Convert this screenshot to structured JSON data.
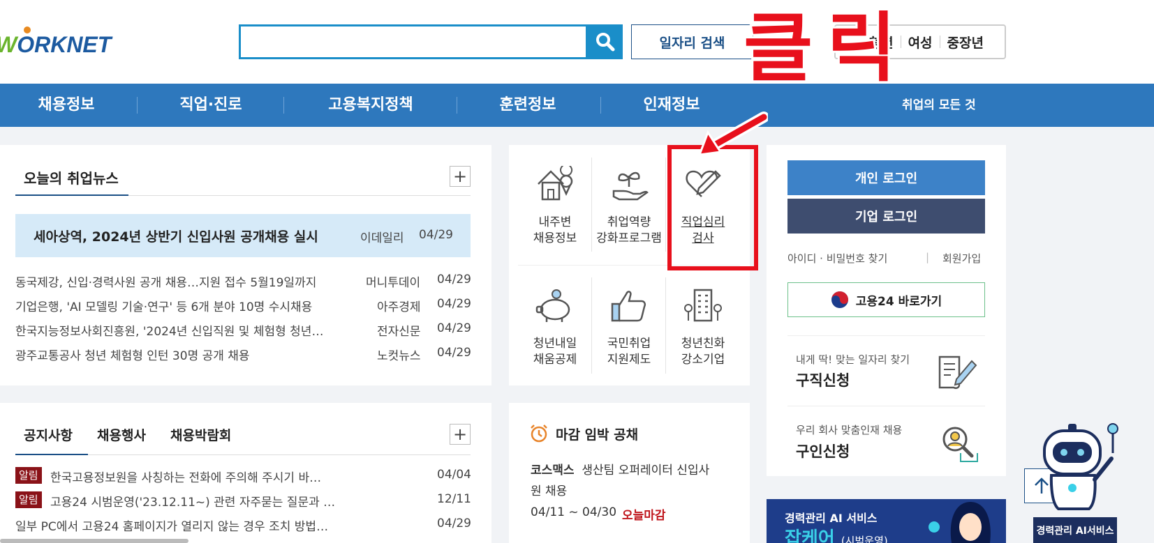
{
  "header": {
    "logo_text": "WORKNET",
    "logo_prefix": "W",
    "logo_rest": "ORKNET",
    "job_search_label": "일자리 검색",
    "quick_links": [
      "청년",
      "여성",
      "중장년"
    ]
  },
  "nav": {
    "items": [
      "채용정보",
      "직업·진로",
      "고용복지정책",
      "훈련정보",
      "인재정보"
    ],
    "extra": "취업의 모든 것"
  },
  "news": {
    "tab_title": "오늘의 취업뉴스",
    "headline": {
      "title": "세아상역, 2024년 상반기 신입사원 공개채용 실시",
      "source": "이데일리",
      "date": "04/29"
    },
    "rows": [
      {
        "title": "동국제강, 신입·경력사원 공개 채용…지원 접수 5월19일까지",
        "source": "머니투데이",
        "date": "04/29"
      },
      {
        "title": "기업은행, 'AI 모델링 기술·연구' 등 6개 분야 10명 수시채용",
        "source": "아주경제",
        "date": "04/29"
      },
      {
        "title": "한국지능정보사회진흥원, '2024년 신입직원 및 체험형 청년…",
        "source": "전자신문",
        "date": "04/29"
      },
      {
        "title": "광주교통공사 청년 체험형 인턴 30명 공개 채용",
        "source": "노컷뉴스",
        "date": "04/29"
      }
    ]
  },
  "tiles": [
    {
      "line1": "내주변",
      "line2": "채용정보",
      "icon": "house-location-icon"
    },
    {
      "line1": "취업역량",
      "line2": "강화프로그램",
      "icon": "plant-hand-icon"
    },
    {
      "line1": "직업심리",
      "line2": "검사",
      "icon": "heart-pen-icon"
    },
    {
      "line1": "청년내일",
      "line2": "채움공제",
      "icon": "piggy-bank-icon"
    },
    {
      "line1": "국민취업",
      "line2": "지원제도",
      "icon": "thumbs-up-icon"
    },
    {
      "line1": "청년친화",
      "line2": "강소기업",
      "icon": "building-icon"
    }
  ],
  "login": {
    "personal": "개인 로그인",
    "company": "기업 로그인",
    "find_account": "아이디 · 비밀번호 찾기",
    "signup": "회원가입",
    "goyong24": "고용24 바로가기"
  },
  "services": [
    {
      "sub": "내게 딱! 맞는 일자리 찾기",
      "main": "구직신청",
      "icon": "document-pen-icon"
    },
    {
      "sub": "우리 회사 맞춤인재 채용",
      "main": "구인신청",
      "icon": "person-search-icon"
    }
  ],
  "annotation": {
    "click_text": "클릭"
  },
  "notices": {
    "tabs": [
      "공지사항",
      "채용행사",
      "채용박람회"
    ],
    "rows": [
      {
        "badge": "알림",
        "title": "한국고용정보원을 사칭하는 전화에 주의해 주시기 바…",
        "date": "04/04"
      },
      {
        "badge": "알림",
        "title": "고용24 시범운영('23.12.11~) 관련 자주묻는 질문과 …",
        "date": "12/11"
      },
      {
        "badge": "",
        "title": "일부 PC에서 고용24 홈페이지가 열리지 않는 경우 조치 방법…",
        "date": "04/29"
      }
    ]
  },
  "deadline": {
    "title": "마감 임박 공채",
    "company": "코스맥스",
    "text_line1": "생산팀 오퍼레이터 신입사",
    "text_line2": "원 채용",
    "period": "04/11 ~ 04/30",
    "status": "오늘마감"
  },
  "banner": {
    "line1": "경력관리 AI 서비스",
    "line2": "잡케어",
    "line2_suffix": "(시범운영)"
  },
  "ai_service_label": "경력관리 AI서비스",
  "colors": {
    "nav_blue": "#2e78bd",
    "search_blue": "#1a8ec9",
    "dark_blue": "#1a4f86",
    "highlight_red": "#e8101c"
  }
}
